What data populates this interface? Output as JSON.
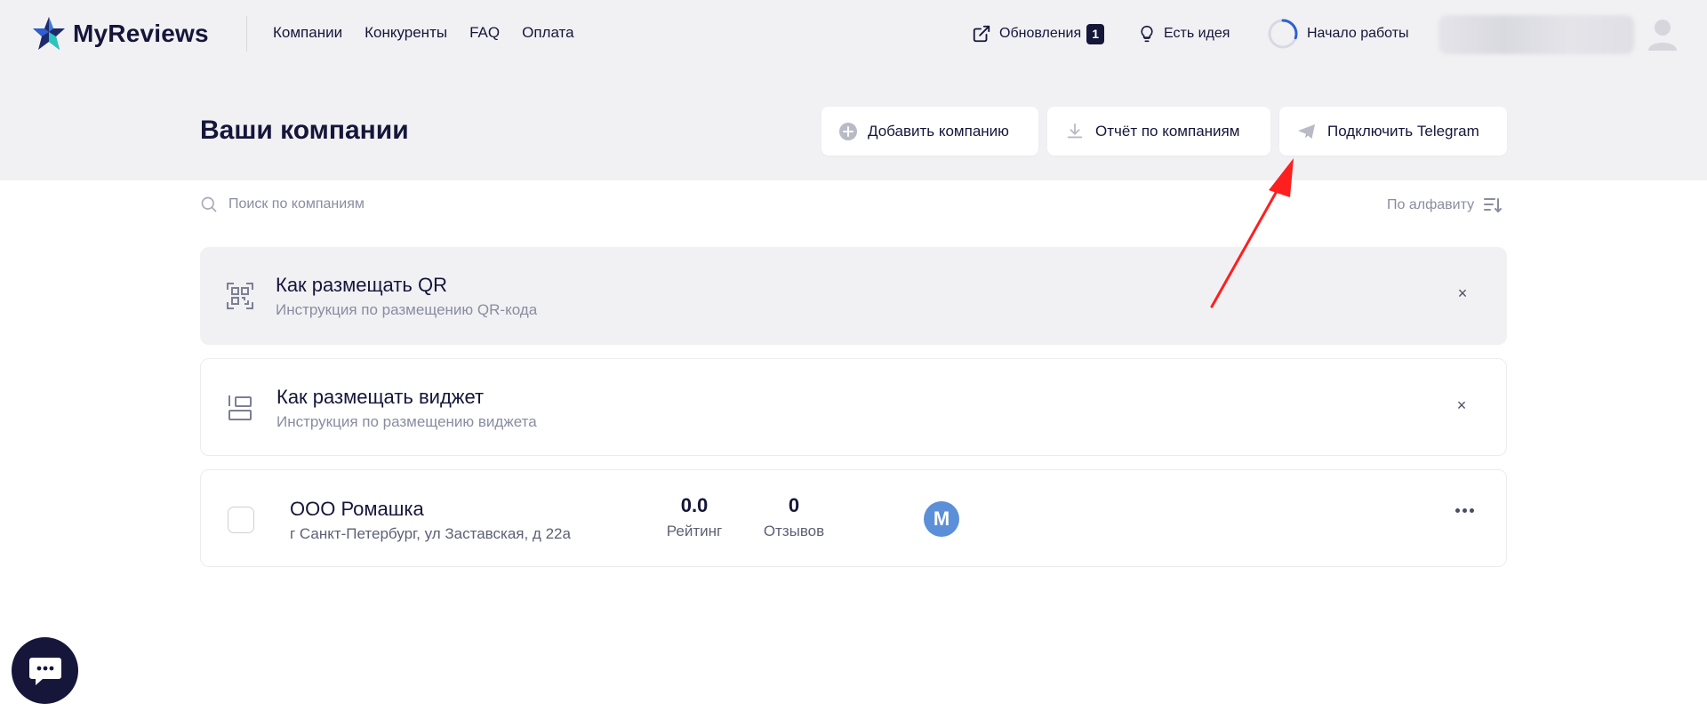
{
  "header": {
    "brand": "MyReviews",
    "nav": [
      "Компании",
      "Конкуренты",
      "FAQ",
      "Оплата"
    ],
    "updates_label": "Обновления",
    "updates_count": "1",
    "idea_label": "Есть идея",
    "start_label": "Начало работы",
    "start_progress": 0.3
  },
  "page": {
    "title": "Ваши компании",
    "buttons": {
      "add": "Добавить компанию",
      "report": "Отчёт по компаниям",
      "telegram": "Подключить Telegram"
    },
    "search_placeholder": "Поиск по компаниям",
    "sort_label": "По алфавиту"
  },
  "tips": [
    {
      "title": "Как размещать QR",
      "subtitle": "Инструкция по размещению QR-кода",
      "close": "×"
    },
    {
      "title": "Как размещать виджет",
      "subtitle": "Инструкция по размещению виджета",
      "close": "×"
    }
  ],
  "companies": [
    {
      "name": "ООО Ромашка",
      "address": "г Санкт-Петербург, ул Заставская, д 22а",
      "rating": "0.0",
      "rating_label": "Рейтинг",
      "reviews": "0",
      "reviews_label": "Отзывов",
      "avatar_letter": "M"
    }
  ],
  "colors": {
    "primary": "#15163a",
    "header_bg": "#f1f1f4",
    "muted_text": "#8a8ca0",
    "avatar_blue": "#5b8fd8",
    "arrow_red": "#ff1f1f"
  },
  "icons": [
    "star-logo-icon",
    "external-link-icon",
    "lightbulb-icon",
    "progress-ring-icon",
    "user-avatar-icon",
    "plus-circle-icon",
    "download-icon",
    "telegram-icon",
    "search-icon",
    "sort-icon",
    "qr-icon",
    "widget-layout-icon",
    "close-icon",
    "more-icon",
    "chat-icon"
  ]
}
